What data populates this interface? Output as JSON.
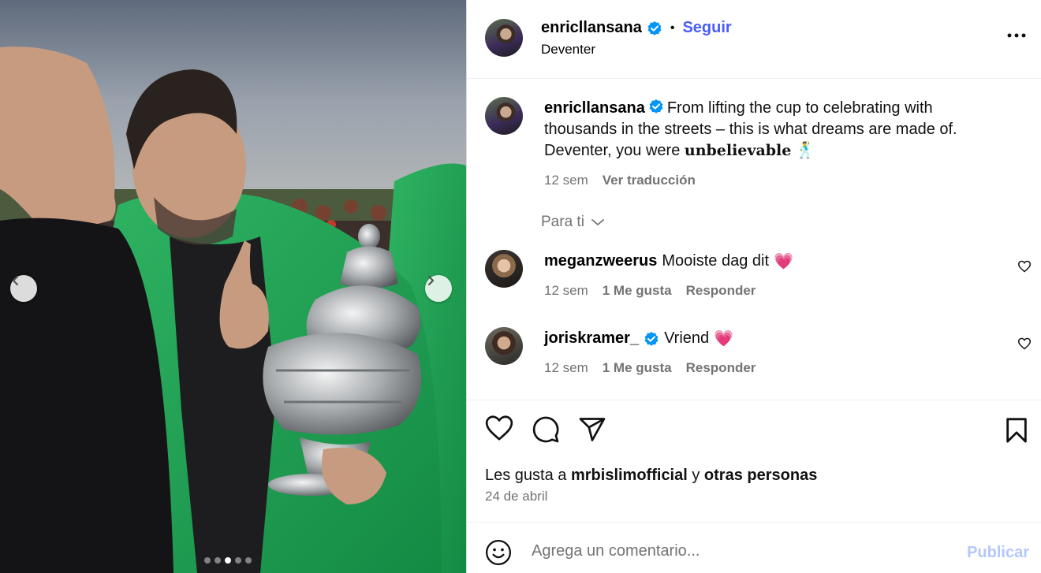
{
  "post": {
    "author": "enricllansana",
    "follow_label": "Seguir",
    "location": "Deventer",
    "caption_text": "From lifting the cup to celebrating with thousands in the streets – this is what dreams are made of. Deventer, you were ",
    "caption_bold": "𝐮𝐧𝐛𝐞𝐥𝐢𝐞𝐯𝐚𝐛𝐥𝐞",
    "caption_emoji": "🕺",
    "caption_time": "12 sem",
    "translate_label": "Ver traducción",
    "likes_prefix": "Les gusta a",
    "likes_user": "mrbislimofficial",
    "likes_and": "y",
    "likes_others": "otras personas",
    "date": "24 de abril"
  },
  "comments_filter": {
    "label": "Para ti"
  },
  "comments": [
    {
      "user": "meganzweerus",
      "text": "Mooiste dag dit",
      "emoji": "💗",
      "verified": false,
      "time": "12 sem",
      "likes": "1 Me gusta",
      "reply": "Responder"
    },
    {
      "user": "joriskramer_",
      "text": "Vriend",
      "emoji": "💗",
      "verified": true,
      "time": "12 sem",
      "likes": "1 Me gusta",
      "reply": "Responder"
    }
  ],
  "composer": {
    "placeholder": "Agrega un comentario...",
    "publish_label": "Publicar"
  },
  "carousel": {
    "slide_count": 5,
    "active_index": 2
  },
  "icons": {
    "verified": "verified-badge-icon",
    "more": "more-options-icon",
    "like": "heart-icon",
    "comment": "comment-icon",
    "share": "share-icon",
    "save": "bookmark-icon",
    "emoji": "emoji-icon",
    "prev": "chevron-left-icon",
    "next": "chevron-right-icon"
  },
  "colors": {
    "accent": "#4a5df9",
    "verified": "#0095f6",
    "secondary_text": "#737373",
    "publish_disabled": "#b3c7fa",
    "emoji_heart": "#ff3f7f"
  }
}
